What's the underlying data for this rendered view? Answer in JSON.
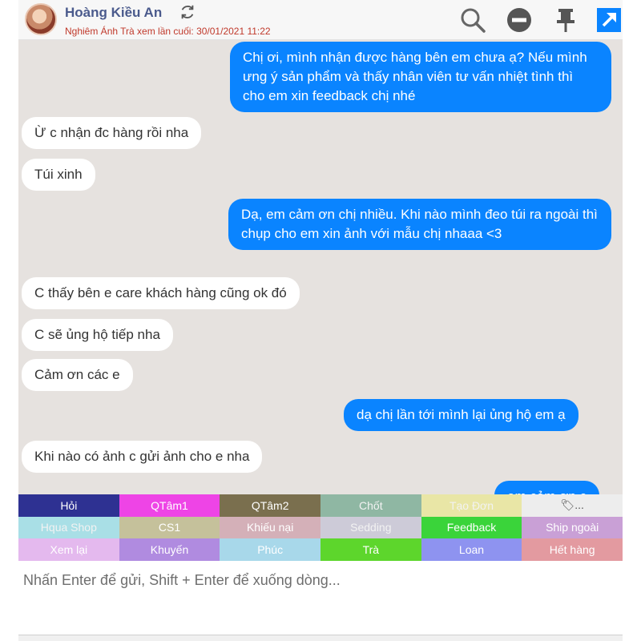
{
  "header": {
    "name": "Hoàng Kiều An",
    "seen_text": "Nghiêm Ánh Trà xem lần cuối: 30/01/2021 11:22"
  },
  "messages": [
    {
      "side": "out",
      "text": "Chị ơi, mình nhận được hàng bên em chưa ạ? Nếu mình ưng ý sản phẩm và thấy nhân viên tư vấn nhiệt tình thì cho em xin feedback chị nhé"
    },
    {
      "side": "in",
      "text": "Ừ c nhận đc hàng rồi nha"
    },
    {
      "side": "in",
      "text": "Túi xinh"
    },
    {
      "side": "out",
      "text": "Dạ, em cảm ơn chị nhiều. Khi nào mình đeo túi ra ngoài thì chụp cho em xin ảnh với mẫu chị nhaaa <3"
    },
    {
      "side": "in",
      "text": "C thấy bên e care khách hàng cũng ok đó"
    },
    {
      "side": "in",
      "text": "C sẽ ủng hộ tiếp nha"
    },
    {
      "side": "in",
      "text": "Cảm ơn các e"
    },
    {
      "side": "out",
      "text": "dạ chị lần tới mình lại ủng hộ em ạ"
    },
    {
      "side": "in",
      "text": "Khi nào có ảnh c gửi ảnh cho e nha"
    },
    {
      "side": "out",
      "text": "em cảm ơn c"
    }
  ],
  "tags": [
    {
      "label": "Hỏi",
      "color": "#2e3192"
    },
    {
      "label": "QTâm1",
      "color": "#ee44e6"
    },
    {
      "label": "QTâm2",
      "color": "#7a6f4e"
    },
    {
      "label": "Chốt",
      "color": "#8fb7a3"
    },
    {
      "label": "Tạo Đơn",
      "color": "#e9e6a6"
    },
    {
      "label": "🏷...",
      "color": "#ededed"
    },
    {
      "label": "Hqua Shop",
      "color": "#a9dfe6"
    },
    {
      "label": "CS1",
      "color": "#c5c19b"
    },
    {
      "label": "Khiếu nại",
      "color": "#d4b0b8"
    },
    {
      "label": "Sedding",
      "color": "#cdcbd8"
    },
    {
      "label": "Feedback",
      "color": "#3ad43a"
    },
    {
      "label": "Ship ngoài",
      "color": "#c9a0d6"
    },
    {
      "label": "Xem lại",
      "color": "#e4b9ee"
    },
    {
      "label": "Khuyến",
      "color": "#b08be0"
    },
    {
      "label": "Phúc",
      "color": "#a8d8ea"
    },
    {
      "label": "Trà",
      "color": "#5dd62c"
    },
    {
      "label": "Loan",
      "color": "#8e93f0"
    },
    {
      "label": "Hết hàng",
      "color": "#e39aa0"
    }
  ],
  "composer": {
    "placeholder": "Nhấn Enter để gửi, Shift + Enter để xuống dòng..."
  }
}
